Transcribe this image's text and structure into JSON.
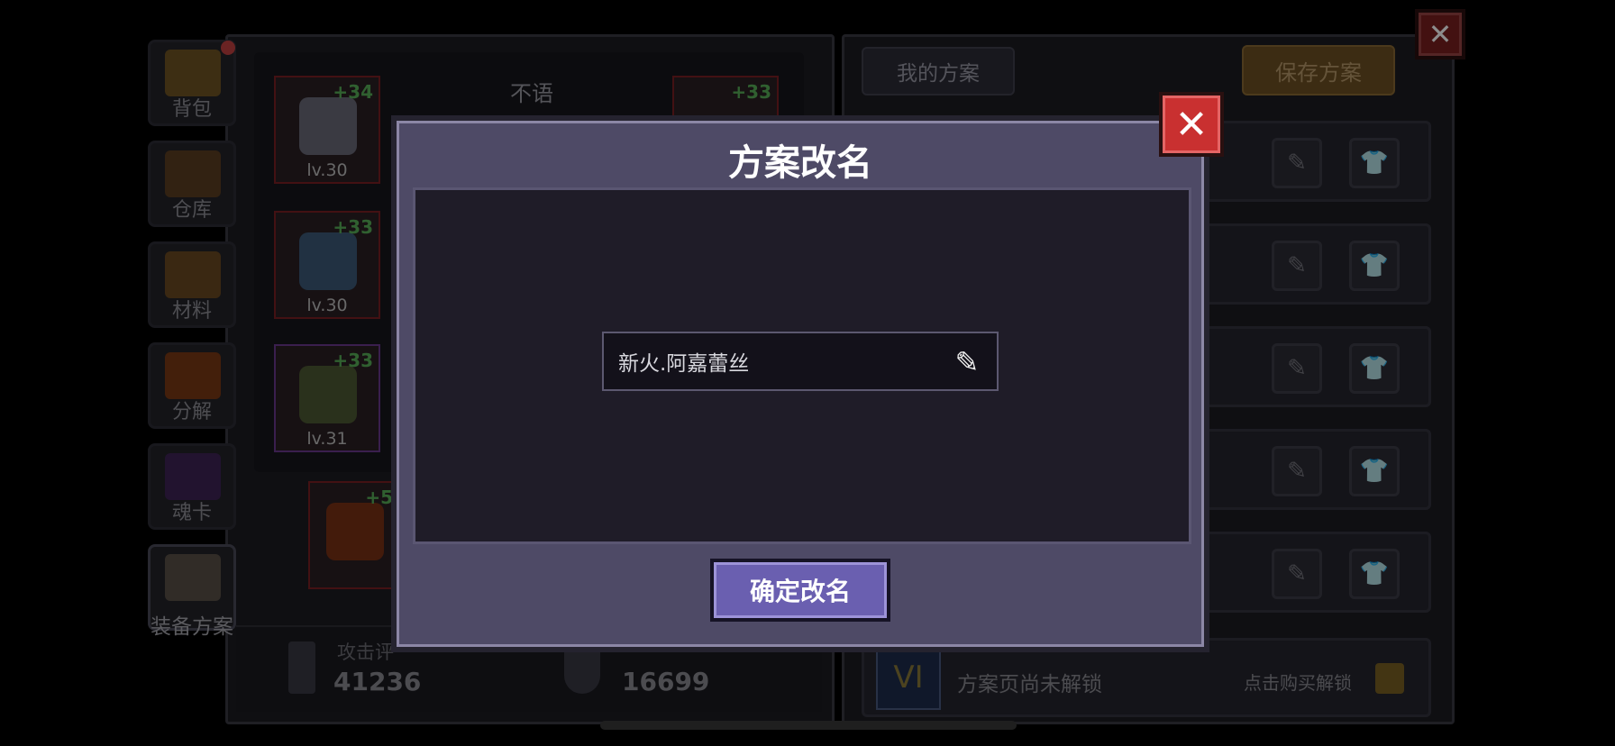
{
  "sidebar_tabs": [
    {
      "label": "背包"
    },
    {
      "label": "仓库"
    },
    {
      "label": "材料"
    },
    {
      "label": "分解"
    },
    {
      "label": "魂卡"
    },
    {
      "label": "装备方案"
    }
  ],
  "character_name": "不语",
  "equipment_slots": [
    {
      "plus": "+34",
      "level": "lv.30"
    },
    {
      "plus": "+33",
      "level": "lv.30"
    },
    {
      "plus": "+33",
      "level": "lv.31"
    },
    {
      "plus": "+33",
      "level": ""
    },
    {
      "plus": "+5",
      "level": ""
    }
  ],
  "stats": {
    "attack_label": "攻击评",
    "attack_value": "41236",
    "defense_value": "16699"
  },
  "plans_panel": {
    "tab_label": "我的方案",
    "save_button_label": "保存方案",
    "locked_text": "方案页尚未解锁",
    "locked_badge": "VI",
    "unlock_text": "点击购买解锁"
  },
  "modal": {
    "title": "方案改名",
    "input_value": "新火.阿嘉蕾丝",
    "confirm_label": "确定改名",
    "close_symbol": "✕"
  },
  "colors": {
    "modal_bg": "#4e4a66",
    "confirm_bg": "#6a5fb0",
    "close_bg": "#c93030",
    "plus_text": "#58b058"
  }
}
